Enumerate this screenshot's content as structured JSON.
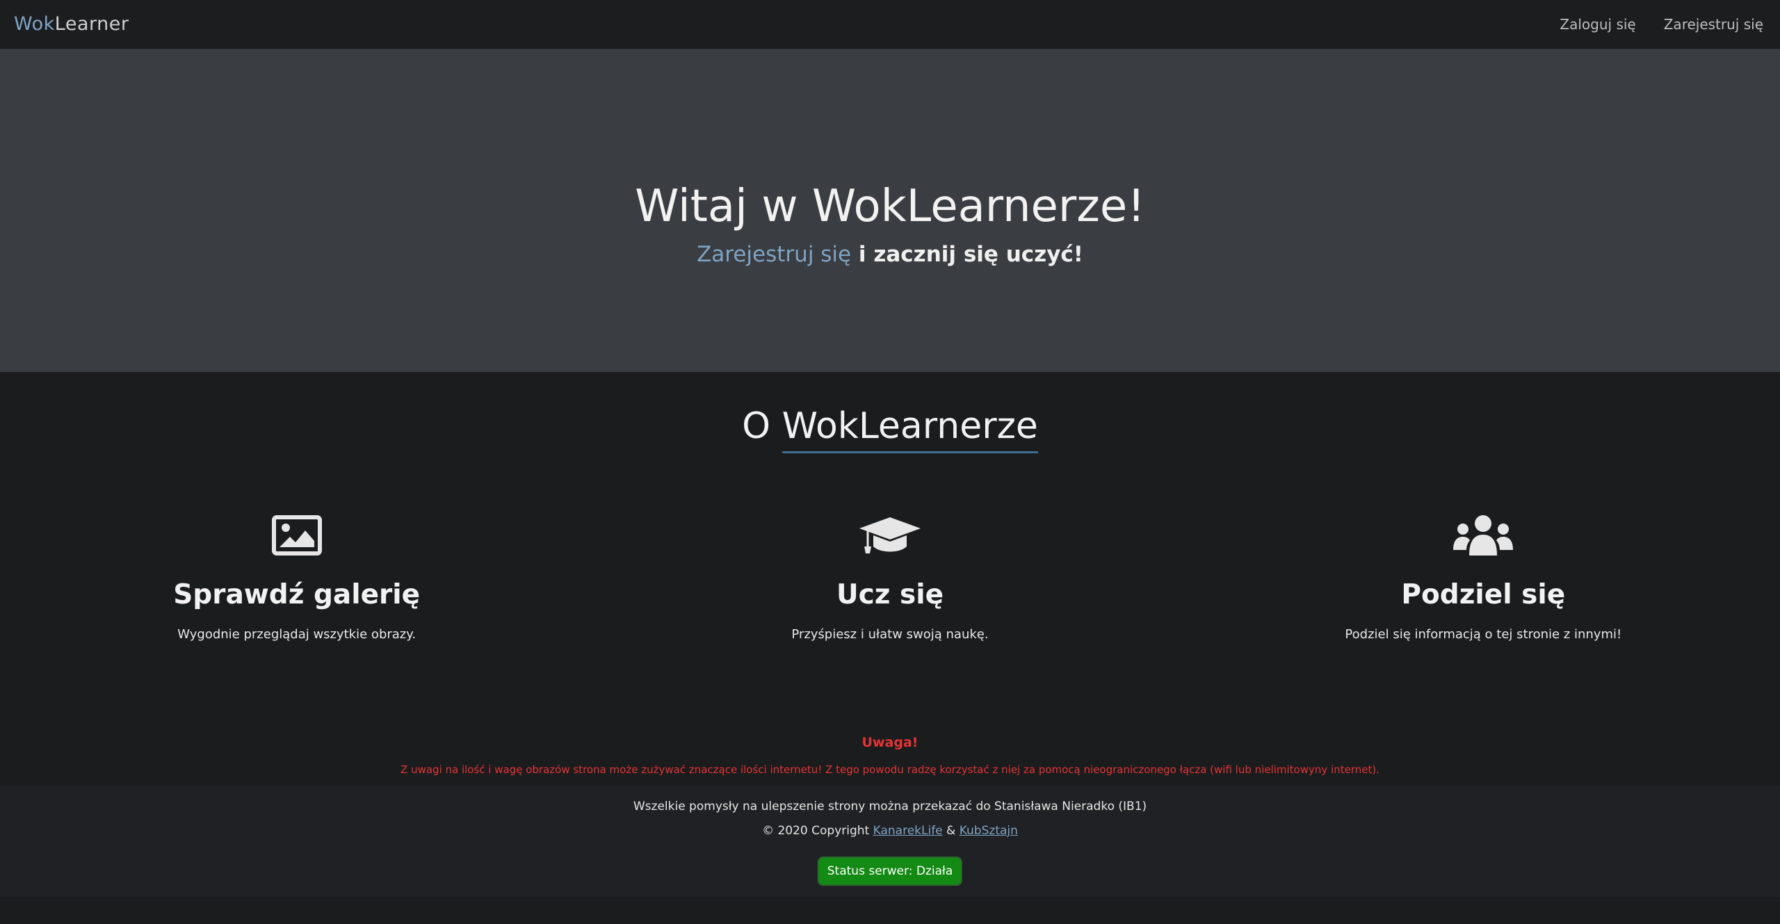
{
  "navbar": {
    "brand_accent": "Wok",
    "brand_rest": "Learner",
    "login": "Zaloguj się",
    "register": "Zarejestruj się"
  },
  "hero": {
    "title": "Witaj w WokLearnerze!",
    "subtitle_link": "Zarejestruj się",
    "subtitle_rest": " i zacznij się uczyć!"
  },
  "about": {
    "title_prefix": "O ",
    "title_underlined": "WokLearnerze",
    "features": [
      {
        "icon": "image-icon",
        "title": "Sprawdź galerię",
        "text": "Wygodnie przeglądaj wszytkie obrazy."
      },
      {
        "icon": "graduation-cap-icon",
        "title": "Ucz się",
        "text": "Przyśpiesz i ułatw swoją naukę."
      },
      {
        "icon": "users-icon",
        "title": "Podziel się",
        "text": "Podziel się informacją o tej stronie z innymi!"
      }
    ]
  },
  "warning": {
    "title": "Uwaga!",
    "text": "Z uwagi na ilość i wagę obrazów strona może zużywać znaczące ilości internetu! Z tego powodu radzę korzystać z niej za pomocą nieograniczonego łącza (wifi lub nielimitowyny internet)."
  },
  "footer": {
    "line1": "Wszelkie pomysły na ulepszenie strony można przekazać do Stanisława Nieradko (IB1)",
    "copyright_prefix": "© 2020 Copyright ",
    "author1": "KanarekLife",
    "separator": " & ",
    "author2": "KubSztajn",
    "status": "Status serwer: Działa"
  },
  "colors": {
    "accent": "#7fa3c4",
    "warning": "#e33434",
    "status_green": "#138a14",
    "hero_bg": "#3a3d41",
    "page_bg": "#1b1c1e"
  }
}
